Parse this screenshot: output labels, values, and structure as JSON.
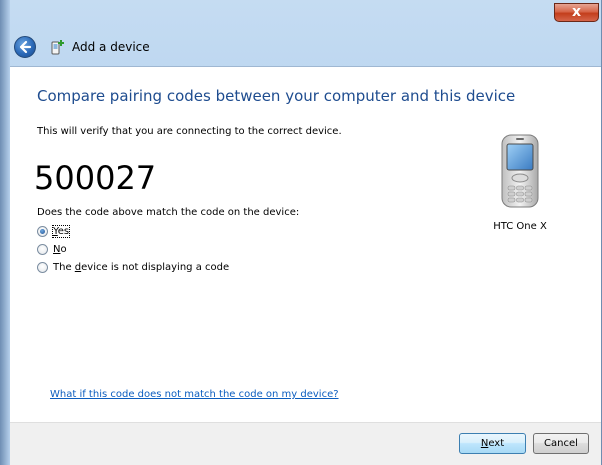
{
  "window": {
    "close_glyph": "x",
    "title": "Add a device"
  },
  "header": {
    "back_icon": "back-arrow-icon",
    "title_icon": "add-device-icon"
  },
  "main": {
    "instruction": "Compare pairing codes between your computer and this device",
    "description": "This will verify that you are connecting to the correct device.",
    "pairing_code": "500027",
    "question": "Does the code above match the code on the device:",
    "options": [
      {
        "pre": "",
        "key": "Y",
        "post": "es",
        "checked": true
      },
      {
        "pre": "",
        "key": "N",
        "post": "o",
        "checked": false
      },
      {
        "pre": "The ",
        "key": "d",
        "post": "evice is not displaying a code",
        "checked": false
      }
    ],
    "device": {
      "name": "HTC One X",
      "icon": "mobile-phone-icon"
    },
    "help_link": "What if this code does not match the code on my device?"
  },
  "footer": {
    "next": {
      "key": "N",
      "post": "ext"
    },
    "cancel": "Cancel"
  },
  "colors": {
    "instruction": "#1e4c8f",
    "link": "#0b5dbf",
    "close": "#c33e1c"
  }
}
